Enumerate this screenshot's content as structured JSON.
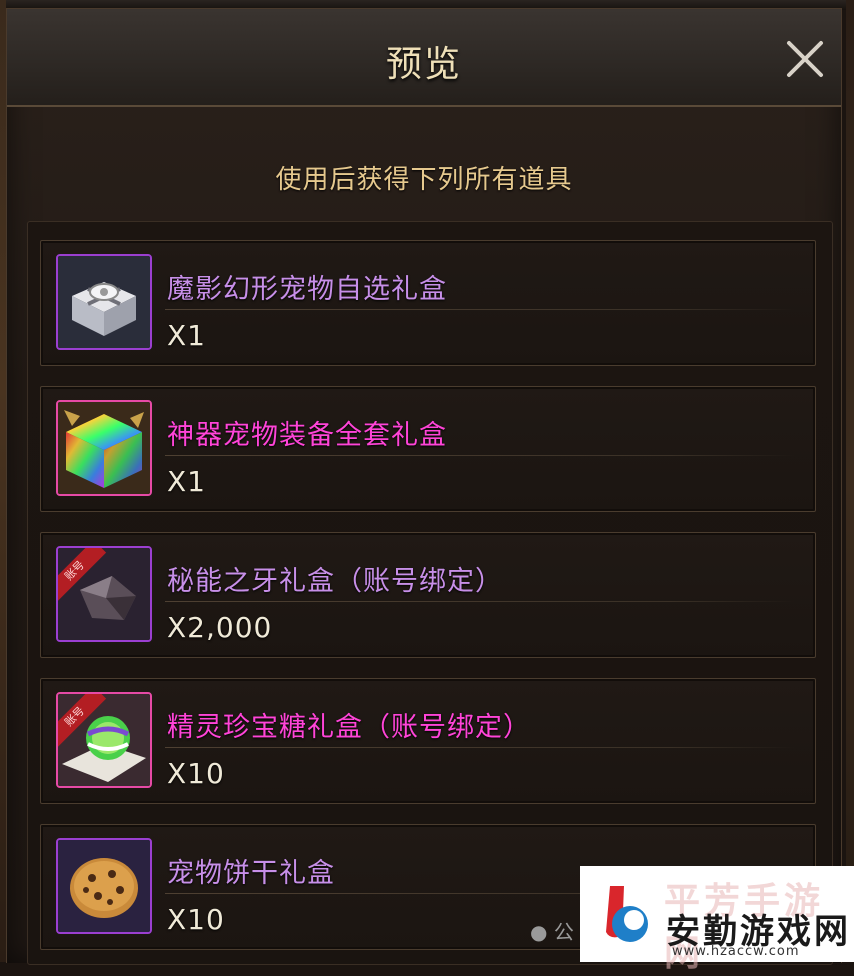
{
  "dialog": {
    "title": "预览",
    "subtitle": "使用后获得下列所有道具",
    "close_icon": "close-icon"
  },
  "items": [
    {
      "name": "魔影幻形宠物自选礼盒",
      "qty": "X1",
      "rarity_color": "#c78fe8",
      "icon": "gift-box-icon"
    },
    {
      "name": "神器宠物装备全套礼盒",
      "qty": "X1",
      "rarity_color": "#ff44d8",
      "icon": "rainbow-gift-box-icon"
    },
    {
      "name": "秘能之牙礼盒（账号绑定）",
      "qty": "X2,000",
      "rarity_color": "#c78fe8",
      "icon": "fang-stone-icon",
      "badge": "账号"
    },
    {
      "name": "精灵珍宝糖礼盒（账号绑定）",
      "qty": "X10",
      "rarity_color": "#ff44d8",
      "icon": "candy-icon",
      "badge": "账号"
    },
    {
      "name": "宠物饼干礼盒",
      "qty": "X10",
      "rarity_color": "#c78fe8",
      "icon": "cookie-icon"
    }
  ],
  "watermark": {
    "site_name": "安勤游戏网",
    "url": "www.hzaccw.com",
    "faded_text": "平芳手游网",
    "wechat_text": "公"
  }
}
